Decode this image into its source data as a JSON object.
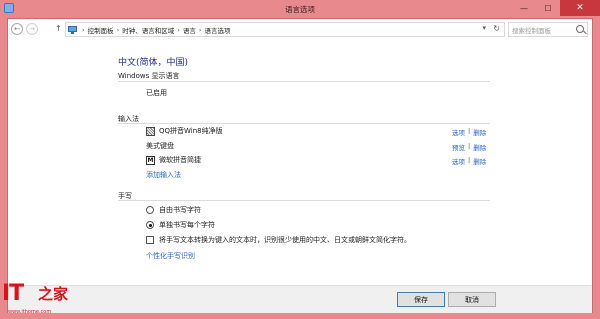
{
  "window": {
    "title": "语言选项",
    "minimize_glyph": "—",
    "maximize_glyph": "☐",
    "close_glyph": "✕"
  },
  "nav": {
    "back_glyph": "←",
    "forward_glyph": "→",
    "up_glyph": "↑",
    "breadcrumb": [
      "控制面板",
      "时钟、语言和区域",
      "语言",
      "语言选项"
    ],
    "separator": "›",
    "dropdown_glyph": "▾",
    "refresh_glyph": "↻",
    "search_placeholder": "搜索控制面板"
  },
  "language": {
    "name": "中文(简体，中国)"
  },
  "windows_display": {
    "label": "Windows 显示语言",
    "status": "已启用"
  },
  "input_methods": {
    "label": "输入法",
    "items": [
      {
        "name": "QQ拼音Win8纯净版",
        "icon_letter": "",
        "actions": [
          "选项",
          "删除"
        ]
      },
      {
        "name": "美式键盘",
        "icon_letter": "",
        "actions": [
          "预览",
          "删除"
        ]
      },
      {
        "name": "微软拼音简捷",
        "icon_letter": "M",
        "actions": [
          "选项",
          "删除"
        ]
      }
    ],
    "action_separator": "|",
    "add_link": "添加输入法"
  },
  "handwriting": {
    "label": "手写",
    "options": [
      {
        "label": "自由书写字符",
        "selected": false
      },
      {
        "label": "单独书写每个字符",
        "selected": true
      }
    ],
    "checkbox_label": "将手写文本转换为键入的文本时，识别很少使用的中文、日文或朝鲜文简化字符。",
    "checkbox_checked": false,
    "personalize_link": "个性化手写识别"
  },
  "footer": {
    "save": "保存",
    "cancel": "取消"
  },
  "watermark": {
    "logo": "IT",
    "logo_cn": "之家",
    "url": "www.ithome.com"
  },
  "icons": {
    "window_icon": "control-panel-icon",
    "address_icon": "control-panel-icon",
    "search_icon": "search-icon"
  },
  "colors": {
    "title_bar": "#e8898e",
    "close_button": "#c7373d",
    "link": "#2a64c5",
    "heading": "#1e3287"
  }
}
